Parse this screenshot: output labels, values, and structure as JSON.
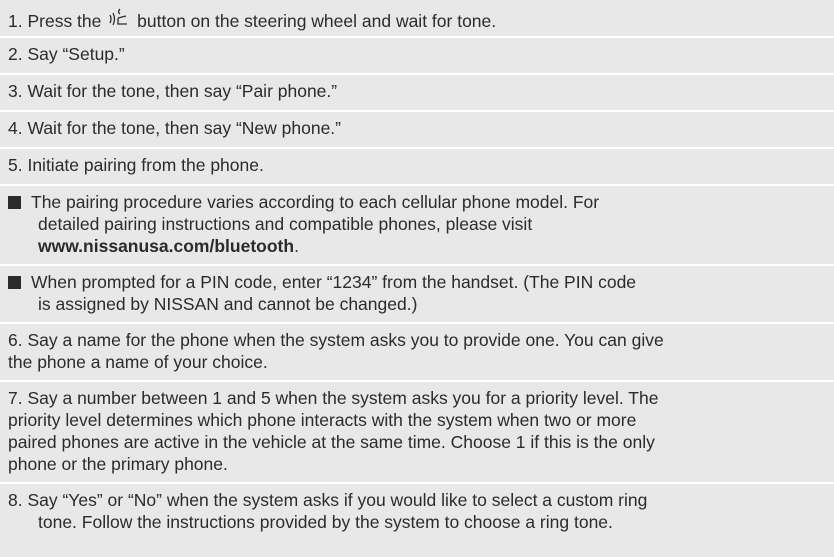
{
  "steps": {
    "s1a": "1. Press the",
    "s1b": "button on the steering wheel and wait for tone.",
    "s2": "2. Say “Setup.”",
    "s3": "3. Wait for the tone, then say “Pair phone.”",
    "s4": "4. Wait for the tone, then say “New phone.”",
    "s5": "5. Initiate pairing from the phone.",
    "note1_l1": "The pairing procedure varies according to each cellular phone model. For",
    "note1_l2": "detailed pairing instructions and compatible phones, please visit",
    "note1_link": "www.nissanusa.com/bluetooth",
    "note1_end": ".",
    "note2_l1": "When prompted for a PIN code, enter “1234” from the handset. (The PIN code",
    "note2_l2": "is assigned by NISSAN and cannot be changed.)",
    "s6_l1": "6.  Say a name for the phone when the system asks you to provide one. You can give",
    "s6_l2": "the phone a name of your choice.",
    "s7_l1": "7.  Say a number between 1 and 5 when the system asks you for a priority level. The",
    "s7_l2": "priority level determines which phone interacts with the system when two or more",
    "s7_l3": "paired phones are active in the vehicle at the same time. Choose 1 if this is the only",
    "s7_l4": "phone or the primary phone.",
    "s8_l1": "8.  Say “Yes” or “No” when the system asks if you would like to select a custom ring",
    "s8_l2": "tone. Follow the instructions provided by the system to choose a ring tone."
  },
  "icons": {
    "talk_button": "voice-talk-icon"
  },
  "colors": {
    "background": "#e8e8e9",
    "text": "#2b2b2b",
    "divider": "#ffffff"
  }
}
